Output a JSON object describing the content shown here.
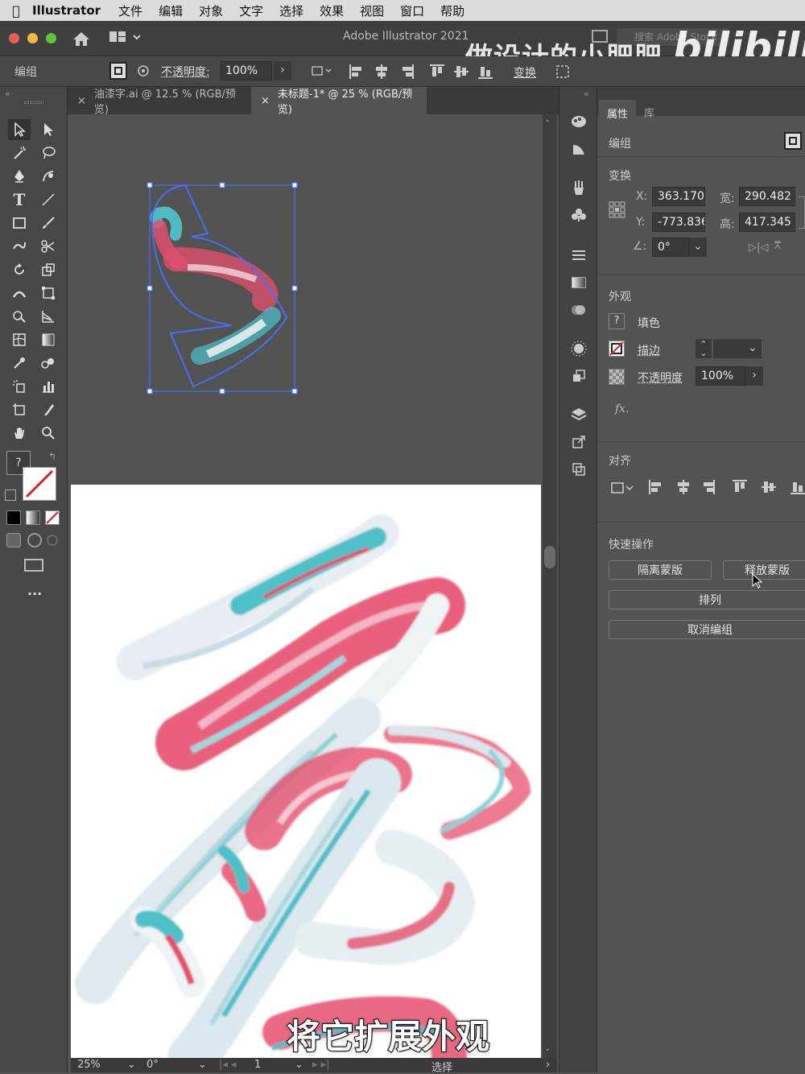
{
  "menubar": {
    "app": "Illustrator",
    "items": [
      "文件",
      "编辑",
      "对象",
      "文字",
      "选择",
      "效果",
      "视图",
      "窗口",
      "帮助"
    ]
  },
  "titlebar": {
    "title": "Adobe Illustrator 2021",
    "search_placeholder": "搜索 Adobe Stock"
  },
  "control_bar": {
    "selection_type": "编组",
    "opacity_label": "不透明度:",
    "opacity_value": "100%",
    "transform_label": "变换"
  },
  "doc_tabs": [
    {
      "label": "油漆字.ai @ 12.5 % (RGB/预览)",
      "active": false
    },
    {
      "label": "未标题-1* @ 25 % (RGB/预览)",
      "active": true
    }
  ],
  "status": {
    "zoom": "25%",
    "rotation": "0°",
    "artboard": "1",
    "tool": "选择"
  },
  "properties": {
    "tab_properties": "属性",
    "tab_libraries": "库",
    "selection_type": "编组",
    "transform_title": "变换",
    "x_label": "X:",
    "x_value": "363.170",
    "y_label": "Y:",
    "y_value": "-773.836",
    "w_label": "宽:",
    "w_value": "290.482",
    "h_label": "高:",
    "h_value": "417.345",
    "angle_value": "0°",
    "appearance_title": "外观",
    "fill_label": "填色",
    "stroke_label": "描边",
    "opacity_label": "不透明度",
    "opacity_value": "100%",
    "fx_label": "fx.",
    "align_title": "对齐",
    "quick_title": "快速操作",
    "btn_isolate": "隔离蒙版",
    "btn_release": "释放蒙版",
    "btn_arrange": "排列",
    "btn_ungroup": "取消编组"
  },
  "overlay": {
    "watermark": "做设计的小肥肥",
    "logo": "bilibili",
    "subtitle": "将它扩展外观"
  },
  "colors": {
    "bg": "#535353",
    "panel": "#474747",
    "selection": "#4a6cf7",
    "paint_pink": "#e5506e",
    "paint_cyan": "#4fc0c8"
  }
}
